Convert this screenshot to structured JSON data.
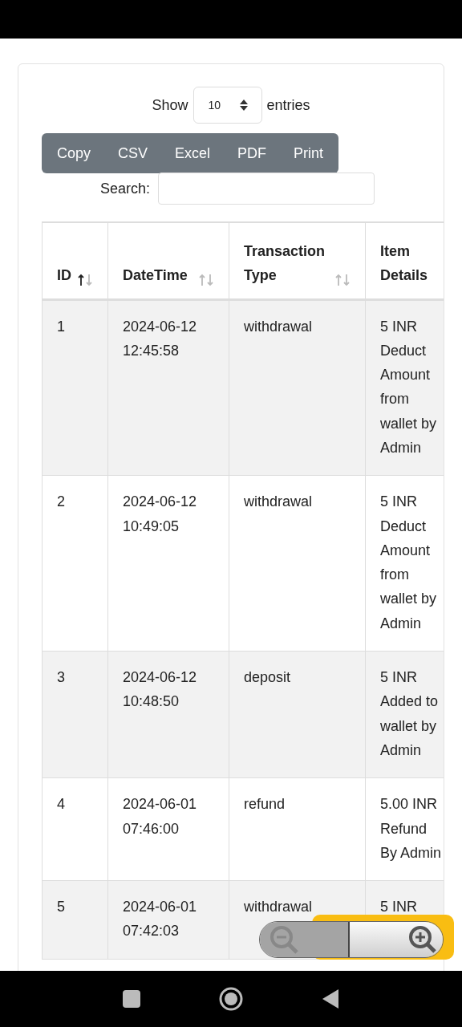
{
  "length_menu": {
    "before": "Show",
    "value": "10",
    "after": "entries"
  },
  "buttons": [
    "Copy",
    "CSV",
    "Excel",
    "PDF",
    "Print"
  ],
  "search": {
    "label": "Search:"
  },
  "table": {
    "columns": [
      {
        "label": "ID",
        "sorted": true
      },
      {
        "label": "DateTime",
        "sorted": false
      },
      {
        "label": "Transaction Type",
        "sorted": false
      },
      {
        "label": "Item Details"
      }
    ],
    "rows": [
      [
        "1",
        "2024-06-12 12:45:58",
        "withdrawal",
        "5 INR Deduct Amount from wallet by Admin"
      ],
      [
        "2",
        "2024-06-12 10:49:05",
        "withdrawal",
        "5 INR Deduct Amount from wallet by Admin"
      ],
      [
        "3",
        "2024-06-12 10:48:50",
        "deposit",
        "5 INR Added to wallet by Admin"
      ],
      [
        "4",
        "2024-06-01 07:46:00",
        "refund",
        "5.00 INR Refund By Admin"
      ],
      [
        "5",
        "2024-06-01 07:42:03",
        "withdrawal",
        "5 INR"
      ]
    ]
  }
}
